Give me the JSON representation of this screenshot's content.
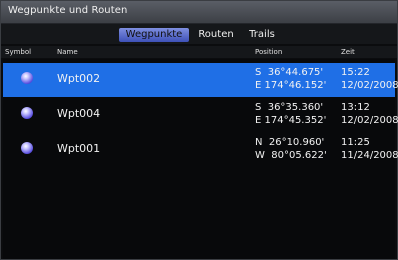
{
  "window": {
    "title": "Wegpunkte und Routen"
  },
  "tabs": [
    {
      "label": "Wegpunkte",
      "active": true
    },
    {
      "label": "Routen",
      "active": false
    },
    {
      "label": "Trails",
      "active": false
    }
  ],
  "columns": {
    "symbol": "Symbol",
    "name": "Name",
    "position": "Position",
    "time": "Zeit"
  },
  "waypoints": [
    {
      "name": "Wpt002",
      "lat": "S  36°44.675'",
      "lon": "E 174°46.152'",
      "time": "15:22",
      "date": "12/02/2008",
      "selected": true,
      "icon": "waypoint-dot-icon"
    },
    {
      "name": "Wpt004",
      "lat": "S  36°35.360'",
      "lon": "E 174°45.352'",
      "time": "13:12",
      "date": "12/02/2008",
      "selected": false,
      "icon": "waypoint-dot-icon"
    },
    {
      "name": "Wpt001",
      "lat": "N  26°10.960'",
      "lon": "W  80°05.622'",
      "time": "11:25",
      "date": "11/24/2008",
      "selected": false,
      "icon": "waypoint-dot-icon"
    }
  ],
  "colors": {
    "selected_row": "#1f6fe6",
    "active_tab": "#5a6bd0",
    "background": "#08090b"
  }
}
